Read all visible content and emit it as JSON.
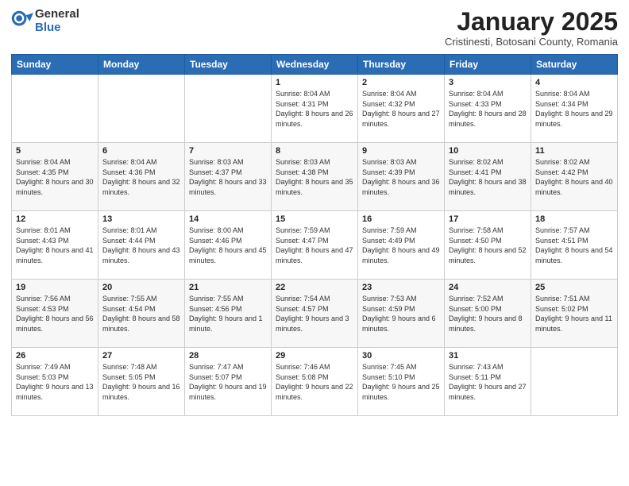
{
  "logo": {
    "general": "General",
    "blue": "Blue"
  },
  "title": "January 2025",
  "location": "Cristinesti, Botosani County, Romania",
  "days_of_week": [
    "Sunday",
    "Monday",
    "Tuesday",
    "Wednesday",
    "Thursday",
    "Friday",
    "Saturday"
  ],
  "weeks": [
    [
      {
        "day": "",
        "info": ""
      },
      {
        "day": "",
        "info": ""
      },
      {
        "day": "",
        "info": ""
      },
      {
        "day": "1",
        "info": "Sunrise: 8:04 AM\nSunset: 4:31 PM\nDaylight: 8 hours and 26 minutes."
      },
      {
        "day": "2",
        "info": "Sunrise: 8:04 AM\nSunset: 4:32 PM\nDaylight: 8 hours and 27 minutes."
      },
      {
        "day": "3",
        "info": "Sunrise: 8:04 AM\nSunset: 4:33 PM\nDaylight: 8 hours and 28 minutes."
      },
      {
        "day": "4",
        "info": "Sunrise: 8:04 AM\nSunset: 4:34 PM\nDaylight: 8 hours and 29 minutes."
      }
    ],
    [
      {
        "day": "5",
        "info": "Sunrise: 8:04 AM\nSunset: 4:35 PM\nDaylight: 8 hours and 30 minutes."
      },
      {
        "day": "6",
        "info": "Sunrise: 8:04 AM\nSunset: 4:36 PM\nDaylight: 8 hours and 32 minutes."
      },
      {
        "day": "7",
        "info": "Sunrise: 8:03 AM\nSunset: 4:37 PM\nDaylight: 8 hours and 33 minutes."
      },
      {
        "day": "8",
        "info": "Sunrise: 8:03 AM\nSunset: 4:38 PM\nDaylight: 8 hours and 35 minutes."
      },
      {
        "day": "9",
        "info": "Sunrise: 8:03 AM\nSunset: 4:39 PM\nDaylight: 8 hours and 36 minutes."
      },
      {
        "day": "10",
        "info": "Sunrise: 8:02 AM\nSunset: 4:41 PM\nDaylight: 8 hours and 38 minutes."
      },
      {
        "day": "11",
        "info": "Sunrise: 8:02 AM\nSunset: 4:42 PM\nDaylight: 8 hours and 40 minutes."
      }
    ],
    [
      {
        "day": "12",
        "info": "Sunrise: 8:01 AM\nSunset: 4:43 PM\nDaylight: 8 hours and 41 minutes."
      },
      {
        "day": "13",
        "info": "Sunrise: 8:01 AM\nSunset: 4:44 PM\nDaylight: 8 hours and 43 minutes."
      },
      {
        "day": "14",
        "info": "Sunrise: 8:00 AM\nSunset: 4:46 PM\nDaylight: 8 hours and 45 minutes."
      },
      {
        "day": "15",
        "info": "Sunrise: 7:59 AM\nSunset: 4:47 PM\nDaylight: 8 hours and 47 minutes."
      },
      {
        "day": "16",
        "info": "Sunrise: 7:59 AM\nSunset: 4:49 PM\nDaylight: 8 hours and 49 minutes."
      },
      {
        "day": "17",
        "info": "Sunrise: 7:58 AM\nSunset: 4:50 PM\nDaylight: 8 hours and 52 minutes."
      },
      {
        "day": "18",
        "info": "Sunrise: 7:57 AM\nSunset: 4:51 PM\nDaylight: 8 hours and 54 minutes."
      }
    ],
    [
      {
        "day": "19",
        "info": "Sunrise: 7:56 AM\nSunset: 4:53 PM\nDaylight: 8 hours and 56 minutes."
      },
      {
        "day": "20",
        "info": "Sunrise: 7:55 AM\nSunset: 4:54 PM\nDaylight: 8 hours and 58 minutes."
      },
      {
        "day": "21",
        "info": "Sunrise: 7:55 AM\nSunset: 4:56 PM\nDaylight: 9 hours and 1 minute."
      },
      {
        "day": "22",
        "info": "Sunrise: 7:54 AM\nSunset: 4:57 PM\nDaylight: 9 hours and 3 minutes."
      },
      {
        "day": "23",
        "info": "Sunrise: 7:53 AM\nSunset: 4:59 PM\nDaylight: 9 hours and 6 minutes."
      },
      {
        "day": "24",
        "info": "Sunrise: 7:52 AM\nSunset: 5:00 PM\nDaylight: 9 hours and 8 minutes."
      },
      {
        "day": "25",
        "info": "Sunrise: 7:51 AM\nSunset: 5:02 PM\nDaylight: 9 hours and 11 minutes."
      }
    ],
    [
      {
        "day": "26",
        "info": "Sunrise: 7:49 AM\nSunset: 5:03 PM\nDaylight: 9 hours and 13 minutes."
      },
      {
        "day": "27",
        "info": "Sunrise: 7:48 AM\nSunset: 5:05 PM\nDaylight: 9 hours and 16 minutes."
      },
      {
        "day": "28",
        "info": "Sunrise: 7:47 AM\nSunset: 5:07 PM\nDaylight: 9 hours and 19 minutes."
      },
      {
        "day": "29",
        "info": "Sunrise: 7:46 AM\nSunset: 5:08 PM\nDaylight: 9 hours and 22 minutes."
      },
      {
        "day": "30",
        "info": "Sunrise: 7:45 AM\nSunset: 5:10 PM\nDaylight: 9 hours and 25 minutes."
      },
      {
        "day": "31",
        "info": "Sunrise: 7:43 AM\nSunset: 5:11 PM\nDaylight: 9 hours and 27 minutes."
      },
      {
        "day": "",
        "info": ""
      }
    ]
  ]
}
